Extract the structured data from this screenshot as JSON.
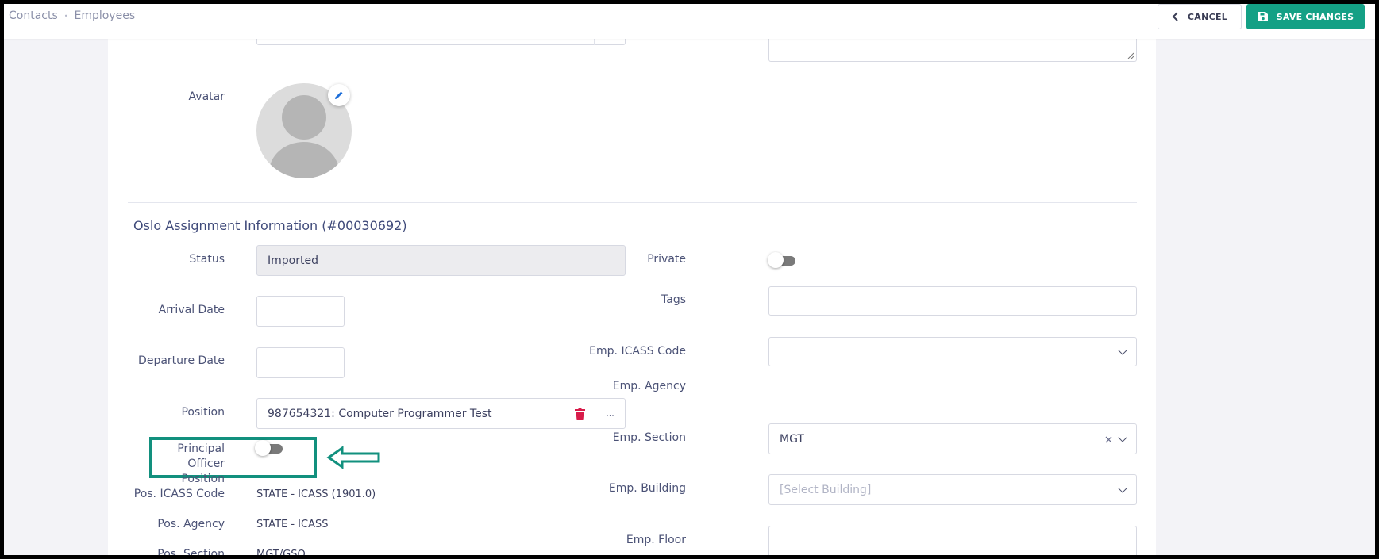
{
  "breadcrumb": {
    "item1": "Contacts",
    "sep": "•",
    "item2": "Employees"
  },
  "actions": {
    "cancel_label": "CANCEL",
    "save_label": "SAVE CHANGES",
    "save_color": "#14a085"
  },
  "avatar": {
    "label": "Avatar"
  },
  "section": {
    "title": "Oslo Assignment Information (#00030692)"
  },
  "left": {
    "status_label": "Status",
    "status_value": "Imported",
    "arrival_label": "Arrival Date",
    "arrival_value": "",
    "departure_label": "Departure Date",
    "departure_value": "",
    "position_label": "Position",
    "position_value": "987654321: Computer Programmer Test",
    "position_more": "...",
    "principal_label": "Principal Officer Position",
    "principal_on": false,
    "pos_icass_label": "Pos. ICASS Code",
    "pos_icass_value": "STATE - ICASS (1901.0)",
    "pos_agency_label": "Pos. Agency",
    "pos_agency_value": "STATE - ICASS",
    "pos_section_label": "Pos. Section",
    "pos_section_value": "MGT/GSO"
  },
  "right": {
    "private_label": "Private",
    "private_on": false,
    "tags_label": "Tags",
    "tags_value": "",
    "emp_icass_label": "Emp. ICASS Code",
    "emp_icass_value": "",
    "emp_agency_label": "Emp. Agency",
    "emp_section_label": "Emp. Section",
    "emp_section_value": "MGT",
    "emp_building_label": "Emp. Building",
    "emp_building_placeholder": "[Select Building]",
    "emp_floor_label": "Emp. Floor",
    "emp_floor_value": ""
  },
  "annotation": {
    "highlight_color": "#12907e"
  }
}
